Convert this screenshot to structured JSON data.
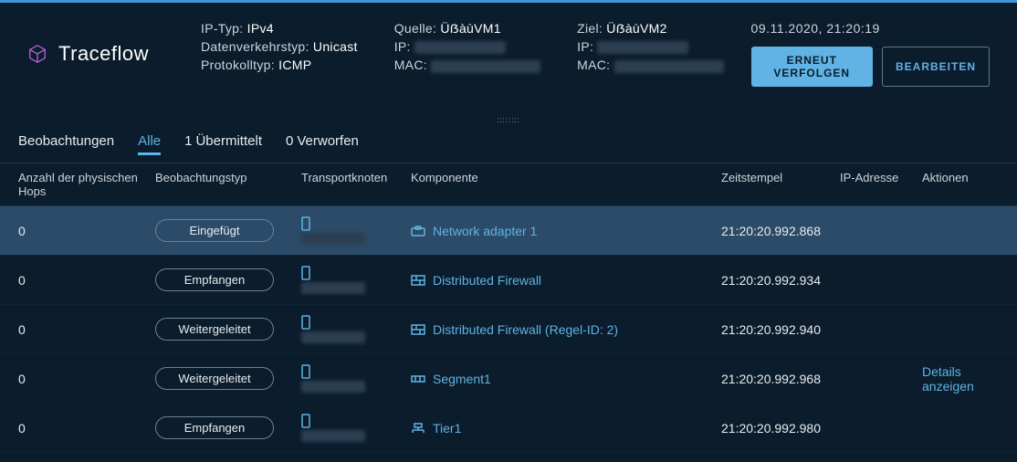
{
  "title": "Traceflow",
  "top_timestamp": "09.11.2020, 21:20:19",
  "btn_retrace": "ERNEUT VERFOLGEN",
  "btn_edit": "BEARBEITEN",
  "info1": [
    {
      "label": "IP-Typ:",
      "value": "IPv4"
    },
    {
      "label": "Datenverkehrstyp:",
      "value": "Unicast"
    },
    {
      "label": "Protokolltyp:",
      "value": "ICMP"
    }
  ],
  "info2": {
    "title_label": "Quelle:",
    "title_value": "ÜẞàùVM1",
    "ip_label": "IP:",
    "mac_label": "MAC:"
  },
  "info3": {
    "title_label": "Ziel:",
    "title_value": "ÜẞàùVM2",
    "ip_label": "IP:",
    "mac_label": "MAC:"
  },
  "tabs": {
    "observations": "Beobachtungen",
    "all": "Alle",
    "delivered_count": "1",
    "delivered_label": "Übermittelt",
    "dropped_count": "0",
    "dropped_label": "Verworfen"
  },
  "columns": {
    "hops": "Anzahl der physischen Hops",
    "type": "Beobachtungstyp",
    "transport": "Transportknoten",
    "component": "Komponente",
    "ts": "Zeitstempel",
    "ip": "IP-Adresse",
    "actions": "Aktionen"
  },
  "rows": [
    {
      "hops": "0",
      "type": "Eingefügt",
      "component_icon": "briefcase",
      "component": "Network adapter 1",
      "ts": "21:20:20.992.868",
      "details": ""
    },
    {
      "hops": "0",
      "type": "Empfangen",
      "component_icon": "firewall",
      "component": "Distributed Firewall",
      "ts": "21:20:20.992.934",
      "details": ""
    },
    {
      "hops": "0",
      "type": "Weitergeleitet",
      "component_icon": "firewall",
      "component": "Distributed Firewall (Regel-ID: 2)",
      "ts": "21:20:20.992.940",
      "details": ""
    },
    {
      "hops": "0",
      "type": "Weitergeleitet",
      "component_icon": "segment",
      "component": "Segment1",
      "ts": "21:20:20.992.968",
      "details": "Details anzeigen"
    },
    {
      "hops": "0",
      "type": "Empfangen",
      "component_icon": "tier",
      "component": "Tier1",
      "ts": "21:20:20.992.980",
      "details": ""
    }
  ]
}
